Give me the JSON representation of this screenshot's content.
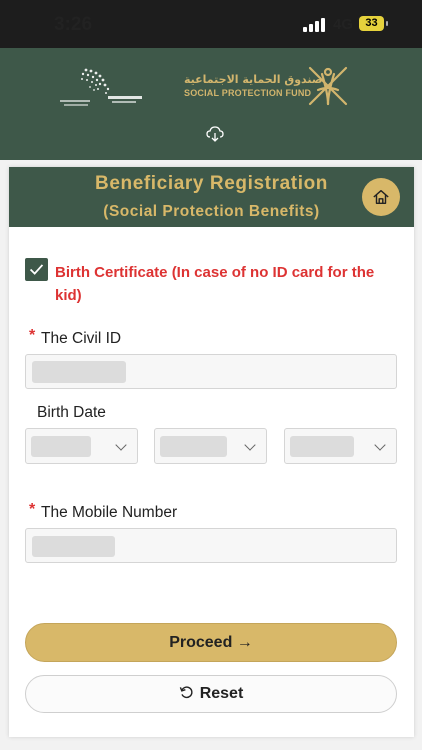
{
  "status_bar": {
    "time": "3:26",
    "network": "4G",
    "battery": "33"
  },
  "header": {
    "org_name_ar": "صندوق الحماية الاجتماعية",
    "org_name_en": "SOCIAL PROTECTION FUND",
    "vision_logo": "oman-vision-2040-logo",
    "emblem": "oman-national-emblem",
    "download_icon": "cloud-download-icon"
  },
  "page": {
    "title": "Beneficiary Registration",
    "subtitle": "(Social Protection Benefits)",
    "home_icon": "home-icon"
  },
  "form": {
    "birth_certificate_checked": true,
    "birth_certificate_label": "Birth Certificate (In case of no ID card for the kid)",
    "required_marker": "*",
    "civil_id_label": "The Civil ID",
    "birth_date_label": "Birth Date",
    "mobile_label": "The Mobile Number"
  },
  "actions": {
    "proceed_label": "Proceed →",
    "reset_label": "Reset",
    "reset_icon": "refresh-icon"
  },
  "colors": {
    "primary_green": "#3e5849",
    "gold": "#d8b869",
    "error_red": "#d33"
  }
}
